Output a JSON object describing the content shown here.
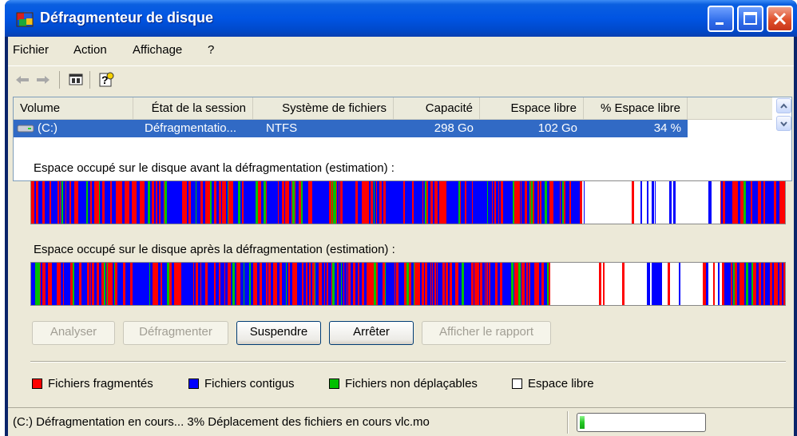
{
  "window": {
    "title": "Défragmenteur de disque"
  },
  "menu": {
    "items": [
      "Fichier",
      "Action",
      "Affichage",
      "?"
    ]
  },
  "toolbar": {
    "icons": [
      "back-arrow-icon",
      "forward-arrow-icon",
      "properties-icon",
      "help-icon"
    ]
  },
  "volumes": {
    "columns": [
      "Volume",
      "État de la session",
      "Système de fichiers",
      "Capacité",
      "Espace libre",
      "% Espace libre"
    ],
    "rows": [
      {
        "volume": "(C:)",
        "state": "Défragmentatio...",
        "filesystem": "NTFS",
        "capacity": "298 Go",
        "free": "102 Go",
        "free_pct": "34 %"
      }
    ]
  },
  "before": {
    "label": "Espace occupé sur le disque avant la défragmentation (estimation) :"
  },
  "after": {
    "label": "Espace occupé sur le disque après la défragmentation (estimation) :"
  },
  "buttons": {
    "analyze": "Analyser",
    "defragment": "Défragmenter",
    "pause": "Suspendre",
    "stop": "Arrêter",
    "report": "Afficher le rapport"
  },
  "legend": {
    "fragmented": "Fichiers fragmentés",
    "contiguous": "Fichiers contigus",
    "unmovable": "Fichiers non déplaçables",
    "free": "Espace libre"
  },
  "colors": {
    "fragmented": "#ff0000",
    "contiguous": "#0000ff",
    "unmovable": "#00c000",
    "free": "#ffffff",
    "selection": "#316ac5"
  },
  "status": {
    "text": "(C:) Défragmentation en cours... 3%  Déplacement des fichiers en cours vlc.mo",
    "progress": 0.03
  }
}
